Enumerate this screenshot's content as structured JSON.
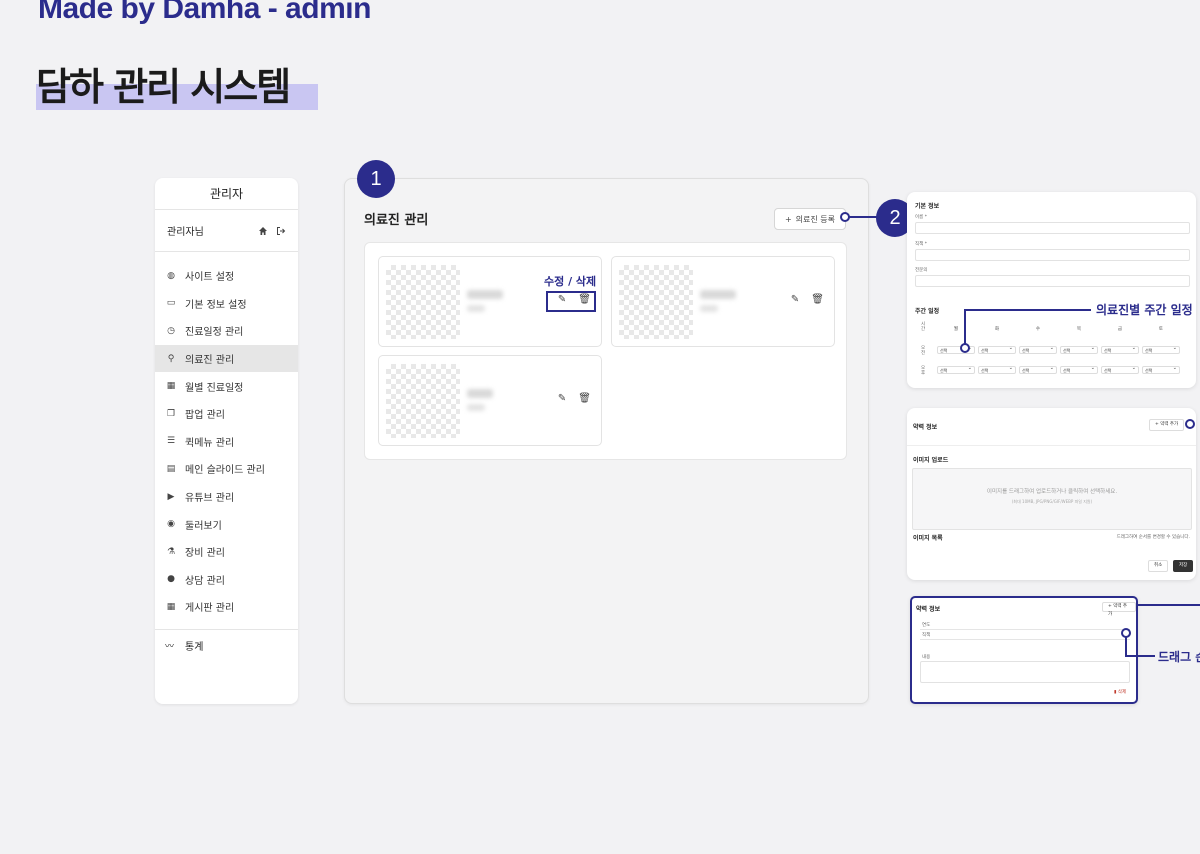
{
  "header": {
    "eyebrow": "Made by Damha - admin",
    "title": "담하 관리 시스템"
  },
  "sidebar": {
    "title": "관리자",
    "user_label": "관리자님",
    "items": [
      {
        "label": "사이트 설정",
        "icon": "globe-icon"
      },
      {
        "label": "기본 정보 설정",
        "icon": "card-icon"
      },
      {
        "label": "진료일정 관리",
        "icon": "clock-icon"
      },
      {
        "label": "의료진 관리",
        "icon": "user-icon",
        "active": true
      },
      {
        "label": "월별 진료일정",
        "icon": "calendar-icon"
      },
      {
        "label": "팝업 관리",
        "icon": "popup-icon"
      },
      {
        "label": "퀵메뉴 관리",
        "icon": "list-icon"
      },
      {
        "label": "메인 슬라이드 관리",
        "icon": "film-icon"
      },
      {
        "label": "유튜브 관리",
        "icon": "youtube-icon"
      },
      {
        "label": "둘러보기",
        "icon": "eye-icon"
      },
      {
        "label": "장비 관리",
        "icon": "microscope-icon"
      },
      {
        "label": "상담 관리",
        "icon": "chat-icon"
      },
      {
        "label": "게시판 관리",
        "icon": "table-icon"
      }
    ],
    "stats_label": "통계"
  },
  "main": {
    "badge": "1",
    "title": "의료진 관리",
    "register_button": "의료진 등록",
    "edit_delete_label": "수정 / 삭제"
  },
  "callouts": {
    "badge2": "2",
    "weekly_schedule": "의료진별 주간 일정",
    "drag_order": "드래그 순"
  },
  "panel_basic": {
    "title": "기본 정보",
    "name_label": "이름 *",
    "role_label": "직책 *",
    "specialty_label": "전문의",
    "schedule_title": "주간 일정",
    "time_col": "시간",
    "days": [
      "월",
      "화",
      "수",
      "목",
      "금",
      "토"
    ],
    "am_label": "오전",
    "pm_label": "오후",
    "select_text": "선택"
  },
  "panel_career": {
    "title": "약력 정보",
    "add_button": "약력 추가",
    "upload_title": "이미지 업로드",
    "dropzone_text": "이미지를 드래그하여 업로드하거나 클릭하여 선택하세요.",
    "dropzone_sub": "(최대 10MB, JPG/PNG/GIF/WEBP 파일 지원)",
    "list_title": "이미지 목록",
    "list_hint": "드래그하여 순서를 변경할 수 있습니다.",
    "cancel": "취소",
    "save": "저장"
  },
  "panel_career2": {
    "title": "약력 정보",
    "add_button": "약력 추가",
    "year_label": "연도",
    "role_label": "직책",
    "content_label": "내용",
    "delete": "삭제"
  }
}
